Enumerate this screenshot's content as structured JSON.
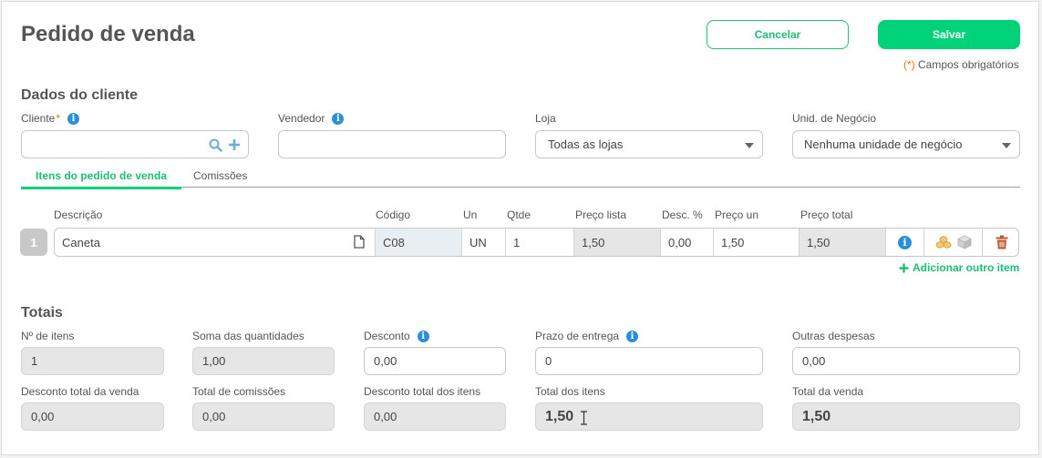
{
  "header": {
    "title": "Pedido de venda",
    "cancel_label": "Cancelar",
    "save_label": "Salvar",
    "required_mark": "(*)",
    "required_note": "Campos obrigatórios"
  },
  "cliente_section": {
    "title": "Dados do cliente",
    "cliente_label": "Cliente",
    "cliente_required": "*",
    "cliente_value": "",
    "vendedor_label": "Vendedor",
    "vendedor_value": "",
    "loja_label": "Loja",
    "loja_value": "Todas as lojas",
    "unid_label": "Unid. de Negócio",
    "unid_value": "Nenhuma unidade de negócio"
  },
  "tabs": [
    {
      "label": "Itens do pedido de venda",
      "active": true
    },
    {
      "label": "Comissões",
      "active": false
    }
  ],
  "items_table": {
    "headers": {
      "descricao": "Descrição",
      "codigo": "Código",
      "un": "Un",
      "qtde": "Qtde",
      "preco_lista": "Preço lista",
      "desc_pct": "Desc. %",
      "preco_un": "Preço un",
      "preco_total": "Preço total"
    },
    "rows": [
      {
        "index": "1",
        "descricao": "Caneta",
        "codigo": "C08",
        "un": "UN",
        "qtde": "1",
        "preco_lista": "1,50",
        "desc_pct": "0,00",
        "preco_un": "1,50",
        "preco_total": "1,50"
      }
    ],
    "add_label": "Adicionar outro item"
  },
  "totais": {
    "title": "Totais",
    "n_itens_label": "Nº de itens",
    "n_itens_value": "1",
    "soma_qtd_label": "Soma das quantidades",
    "soma_qtd_value": "1,00",
    "desconto_label": "Desconto",
    "desconto_value": "0,00",
    "prazo_label": "Prazo de entrega",
    "prazo_value": "0",
    "outras_label": "Outras despesas",
    "outras_value": "0,00",
    "desc_total_venda_label": "Desconto total da venda",
    "desc_total_venda_value": "0,00",
    "total_comissoes_label": "Total de comissões",
    "total_comissoes_value": "0,00",
    "desc_total_itens_label": "Desconto total dos itens",
    "desc_total_itens_value": "0,00",
    "total_itens_label": "Total dos itens",
    "total_itens_value": "1,50",
    "total_venda_label": "Total da venda",
    "total_venda_value": "1,50"
  },
  "colors": {
    "accent": "#00d27a",
    "info": "#2a8fd8",
    "required": "#e07b00",
    "delete": "#c0552b"
  },
  "icons": [
    "info-icon",
    "search-icon",
    "plus-icon",
    "chevron-down-icon",
    "document-icon",
    "coins-icon",
    "box-icon",
    "trash-icon",
    "text-cursor-icon"
  ]
}
